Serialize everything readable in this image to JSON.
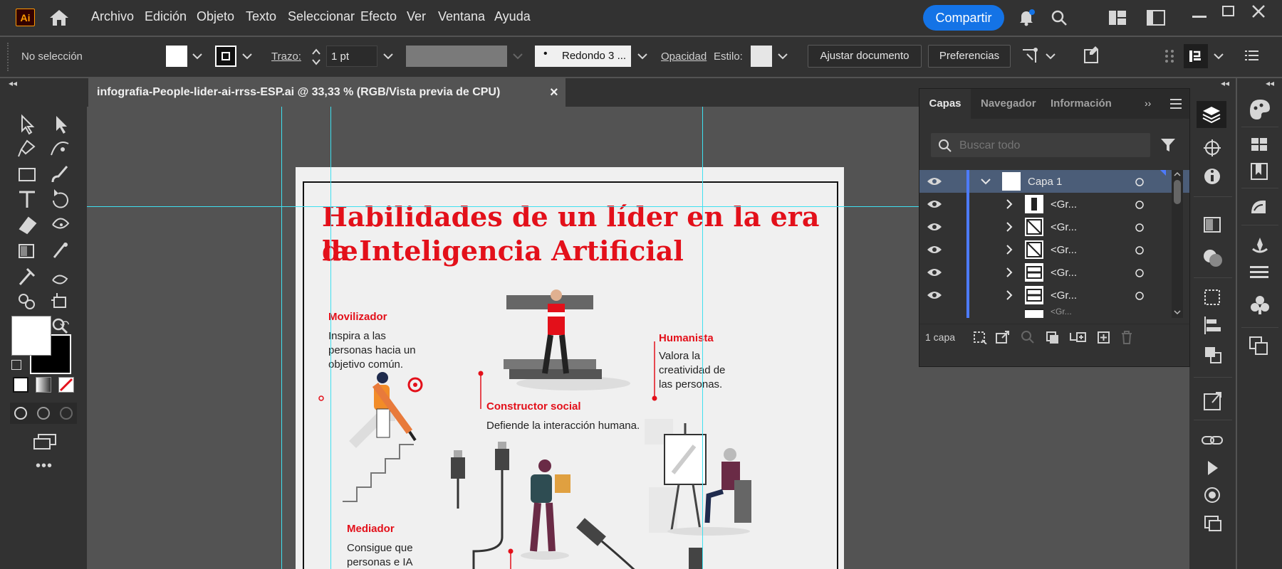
{
  "app": {
    "logo": "Ai"
  },
  "menu": [
    "Archivo",
    "Edición",
    "Objeto",
    "Texto",
    "Seleccionar",
    "Efecto",
    "Ver",
    "Ventana",
    "Ayuda"
  ],
  "header": {
    "share_label": "Compartir"
  },
  "control_bar": {
    "selection_status": "No selección",
    "stroke_label": "Trazo:",
    "stroke_value": "1 pt",
    "brush_value": "Redondo 3 ...",
    "opacity_label": "Opacidad",
    "style_label": "Estilo:",
    "adjust_doc_label": "Ajustar documento",
    "preferences_label": "Preferencias"
  },
  "document": {
    "tab_title": "infografia-People-lider-ai-rrss-ESP.ai @ 33,33 % (RGB/Vista previa de CPU)",
    "close_glyph": "×"
  },
  "artboard": {
    "title_line1": "Habilidades de un líder en la era de",
    "title_line2": "la Inteligencia Artificial",
    "sections": [
      {
        "heading": "Movilizador",
        "body": [
          "Inspira a las",
          "personas hacia un",
          "objetivo común."
        ]
      },
      {
        "heading": "Humanista",
        "body": [
          "Valora la",
          "creatividad de",
          "las personas."
        ]
      },
      {
        "heading": "Constructor social",
        "body": [
          "Defiende la interacción humana."
        ]
      },
      {
        "heading": "Mediador",
        "body": [
          "Consigue que",
          "personas e IA"
        ]
      }
    ]
  },
  "layers_panel": {
    "tabs": [
      "Capas",
      "Navegador",
      "Información"
    ],
    "search_placeholder": "Buscar todo",
    "layer_name": "Capa 1",
    "groups": [
      "<Gr...",
      "<Gr...",
      "<Gr...",
      "<Gr...",
      "<Gr...",
      "<Gr..."
    ],
    "footer_count": "1 capa"
  },
  "colors": {
    "accent": "#1473e6",
    "title_red": "#e3101a",
    "guide": "#3ee0f0",
    "selected_row": "#4b5d78"
  }
}
